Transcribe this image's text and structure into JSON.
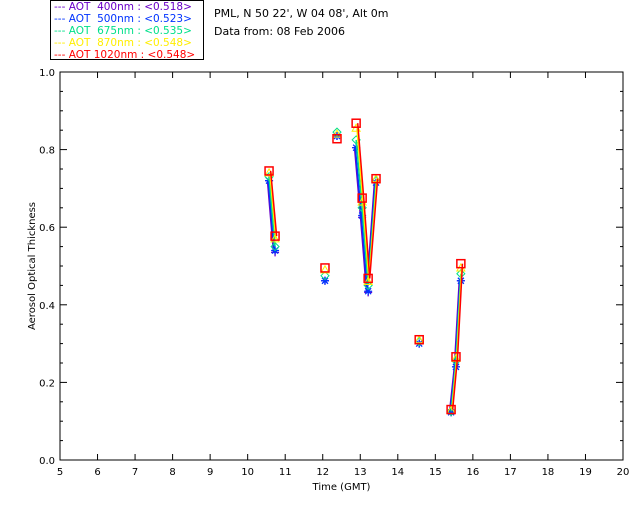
{
  "header": {
    "site": "PML, N 50 22', W 04 08', Alt 0m",
    "date": "Data from: 08 Feb 2006"
  },
  "chart_data": {
    "type": "line",
    "xlabel": "Time (GMT)",
    "ylabel": "Aerosol Optical Thickness",
    "xlim": [
      5,
      20
    ],
    "ylim": [
      0.0,
      1.0
    ],
    "xticks": [
      "5",
      "6",
      "7",
      "8",
      "9",
      "10",
      "11",
      "12",
      "13",
      "14",
      "15",
      "16",
      "17",
      "18",
      "19",
      "20"
    ],
    "yticks": [
      "0.0",
      "0.2",
      "0.4",
      "0.6",
      "0.8",
      "1.0"
    ],
    "grid": false,
    "legend_placement": "top-left outside",
    "x": [
      10.57,
      10.73,
      12.06,
      12.38,
      12.89,
      13.05,
      13.21,
      13.42,
      14.57,
      15.42,
      15.55,
      15.68
    ],
    "segments": [
      [
        0,
        1
      ],
      [
        2
      ],
      [
        3
      ],
      [
        4,
        5,
        6,
        7
      ],
      [
        8
      ],
      [
        9,
        10,
        11
      ]
    ],
    "series": [
      {
        "name": "AOT  400nm : <0.518>",
        "color": "#6a00c8",
        "marker": "plus",
        "values": [
          0.72,
          0.535,
          0.462,
          0.835,
          0.805,
          0.625,
          0.432,
          0.715,
          0.3,
          0.123,
          0.24,
          0.462
        ]
      },
      {
        "name": "AOT  500nm : <0.523>",
        "color": "#0033ff",
        "marker": "asterisk",
        "values": [
          0.72,
          0.54,
          0.462,
          0.835,
          0.805,
          0.63,
          0.435,
          0.715,
          0.3,
          0.123,
          0.24,
          0.462
        ]
      },
      {
        "name": "AOT  675nm : <0.535>",
        "color": "#00e08a",
        "marker": "diamond",
        "values": [
          0.73,
          0.55,
          0.475,
          0.845,
          0.825,
          0.65,
          0.45,
          0.72,
          0.305,
          0.125,
          0.255,
          0.48
        ]
      },
      {
        "name": "AOT  870nm : <0.548>",
        "color": "#ffee00",
        "marker": "triangle",
        "values": [
          0.74,
          0.57,
          0.49,
          0.84,
          0.855,
          0.665,
          0.46,
          0.725,
          0.31,
          0.128,
          0.262,
          0.495
        ]
      },
      {
        "name": "AOT 1020nm : <0.548>",
        "color": "#ff0000",
        "marker": "square",
        "values": [
          0.745,
          0.577,
          0.495,
          0.828,
          0.868,
          0.675,
          0.468,
          0.725,
          0.31,
          0.13,
          0.266,
          0.506
        ]
      }
    ]
  }
}
